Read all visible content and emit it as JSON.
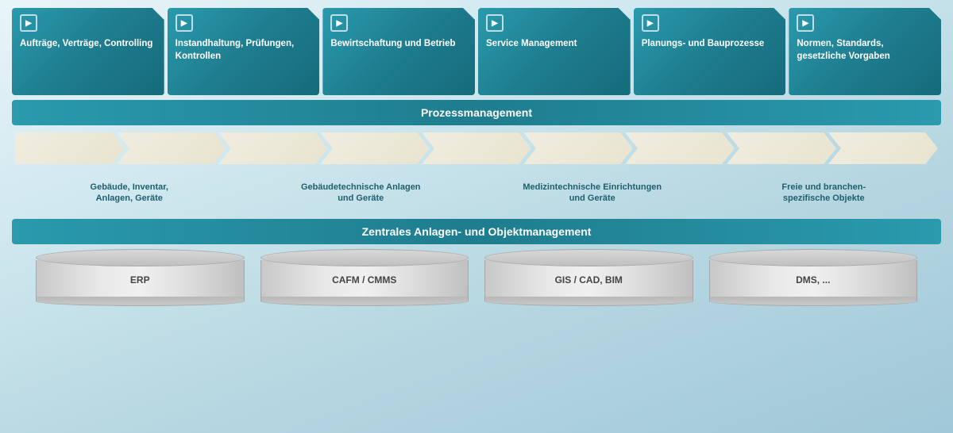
{
  "tiles": [
    {
      "id": "tile-1",
      "label": "Aufträge, Verträge, Controlling"
    },
    {
      "id": "tile-2",
      "label": "Instandhaltung, Prüfungen, Kontrollen"
    },
    {
      "id": "tile-3",
      "label": "Bewirtschaftung und Betrieb"
    },
    {
      "id": "tile-4",
      "label": "Service Management"
    },
    {
      "id": "tile-5",
      "label": "Planungs- und Bauprozesse"
    },
    {
      "id": "tile-6",
      "label": "Normen, Standards, gesetzliche Vorgaben"
    }
  ],
  "prozessmanagement_label": "Prozessmanagement",
  "arrows_count": 9,
  "objects": [
    {
      "id": "obj-1",
      "label": "Gebäude, Inventar,\nAnlagen, Geräte"
    },
    {
      "id": "obj-2",
      "label": "Gebäudetechnische Anlagen\nund Geräte"
    },
    {
      "id": "obj-3",
      "label": "Medizintechnische Einrichtungen\nund Geräte"
    },
    {
      "id": "obj-4",
      "label": "Freie und branchen-\nspezifische Objekte"
    }
  ],
  "zentral_label": "Zentrales Anlagen- und Objektmanagement",
  "databases": [
    {
      "id": "db-1",
      "label": "ERP"
    },
    {
      "id": "db-2",
      "label": "CAFM / CMMS"
    },
    {
      "id": "db-3",
      "label": "GIS / CAD, BIM"
    },
    {
      "id": "db-4",
      "label": "DMS, ..."
    }
  ]
}
